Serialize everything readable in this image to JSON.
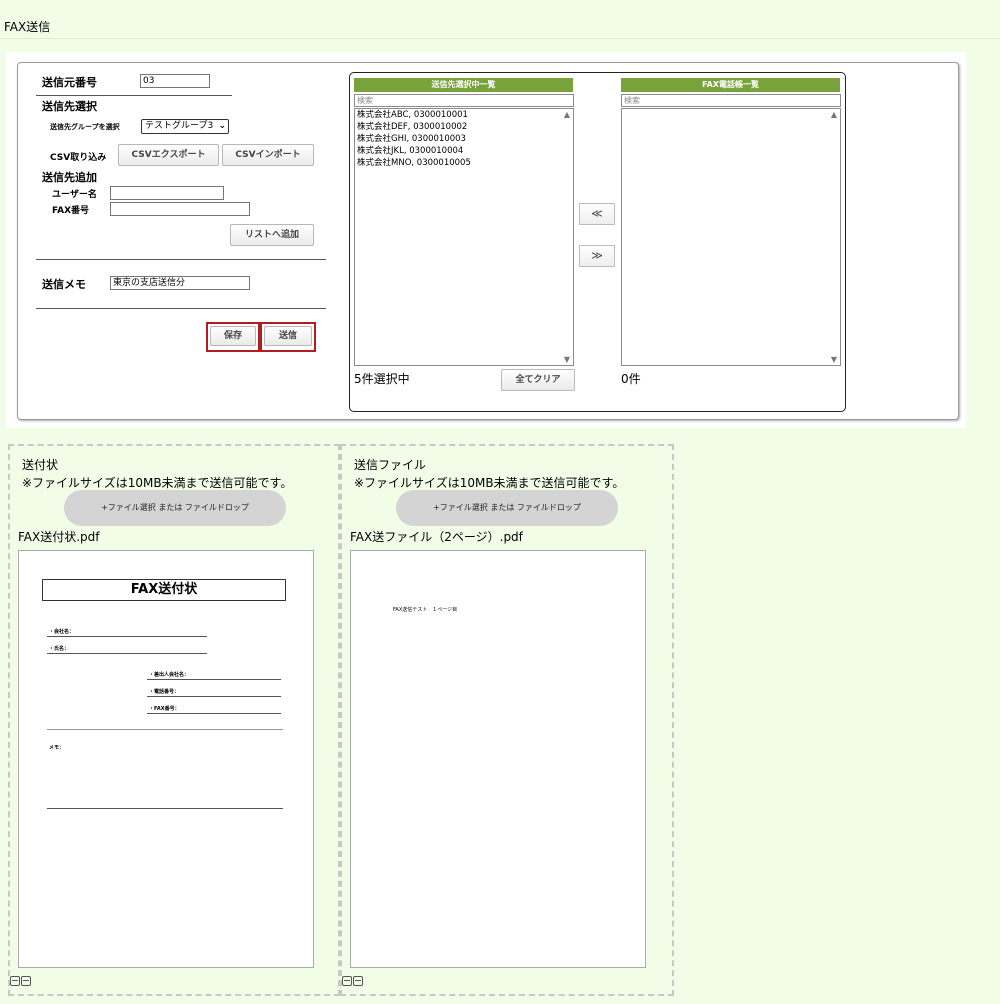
{
  "page": {
    "title": "FAX送信"
  },
  "form": {
    "sender_number_label": "送信元番号",
    "sender_number_value": "03",
    "dest_select_label": "送信先選択",
    "group_select_label": "送信先グループを選択",
    "group_select_value": "テストグループ3",
    "csv_label": "CSV取り込み",
    "csv_export_button": "CSVエクスポート",
    "csv_import_button": "CSVインポート",
    "add_dest_label": "送信先追加",
    "username_label": "ユーザー名",
    "username_value": "",
    "fax_number_label": "FAX番号",
    "fax_number_value": "",
    "add_to_list_button": "リストへ追加",
    "memo_label": "送信メモ",
    "memo_value": "東京の支店送信分",
    "save_button": "保存",
    "send_button": "送信"
  },
  "selected_list": {
    "header": "送信先選択中一覧",
    "search_placeholder": "検索",
    "items": [
      "株式会社ABC, 0300010001",
      "株式会社DEF, 0300010002",
      "株式会社GHI, 0300010003",
      "株式会社JKL, 0300010004",
      "株式会社MNO, 0300010005"
    ],
    "count_text": "5件選択中",
    "clear_all_button": "全てクリア"
  },
  "phonebook_list": {
    "header": "FAX電話帳一覧",
    "search_placeholder": "検索",
    "items": [],
    "count_text": "0件"
  },
  "move_buttons": {
    "move_left": "≪",
    "move_right": "≫"
  },
  "cover_upload": {
    "title": "送付状",
    "note": "※ファイルサイズは10MB未満まで送信可能です。",
    "drop_label": "+ファイル選択 または ファイルドロップ",
    "file_name": "FAX送付状.pdf",
    "preview": {
      "doc_title": "FAX送付状",
      "company_label": "・会社名：",
      "name_label": "・氏名：",
      "sender_company_label": "・差出人会社名：",
      "phone_label": "・電話番号：",
      "fax_label": "・FAX番号：",
      "memo_label": "メモ："
    }
  },
  "send_upload": {
    "title": "送信ファイル",
    "note": "※ファイルサイズは10MB未満まで送信可能です。",
    "drop_label": "+ファイル選択 または ファイルドロップ",
    "file_name": "FAX送ファイル（2ページ）.pdf",
    "preview": {
      "page_text": "FAX送信テスト　１ページ目"
    }
  }
}
